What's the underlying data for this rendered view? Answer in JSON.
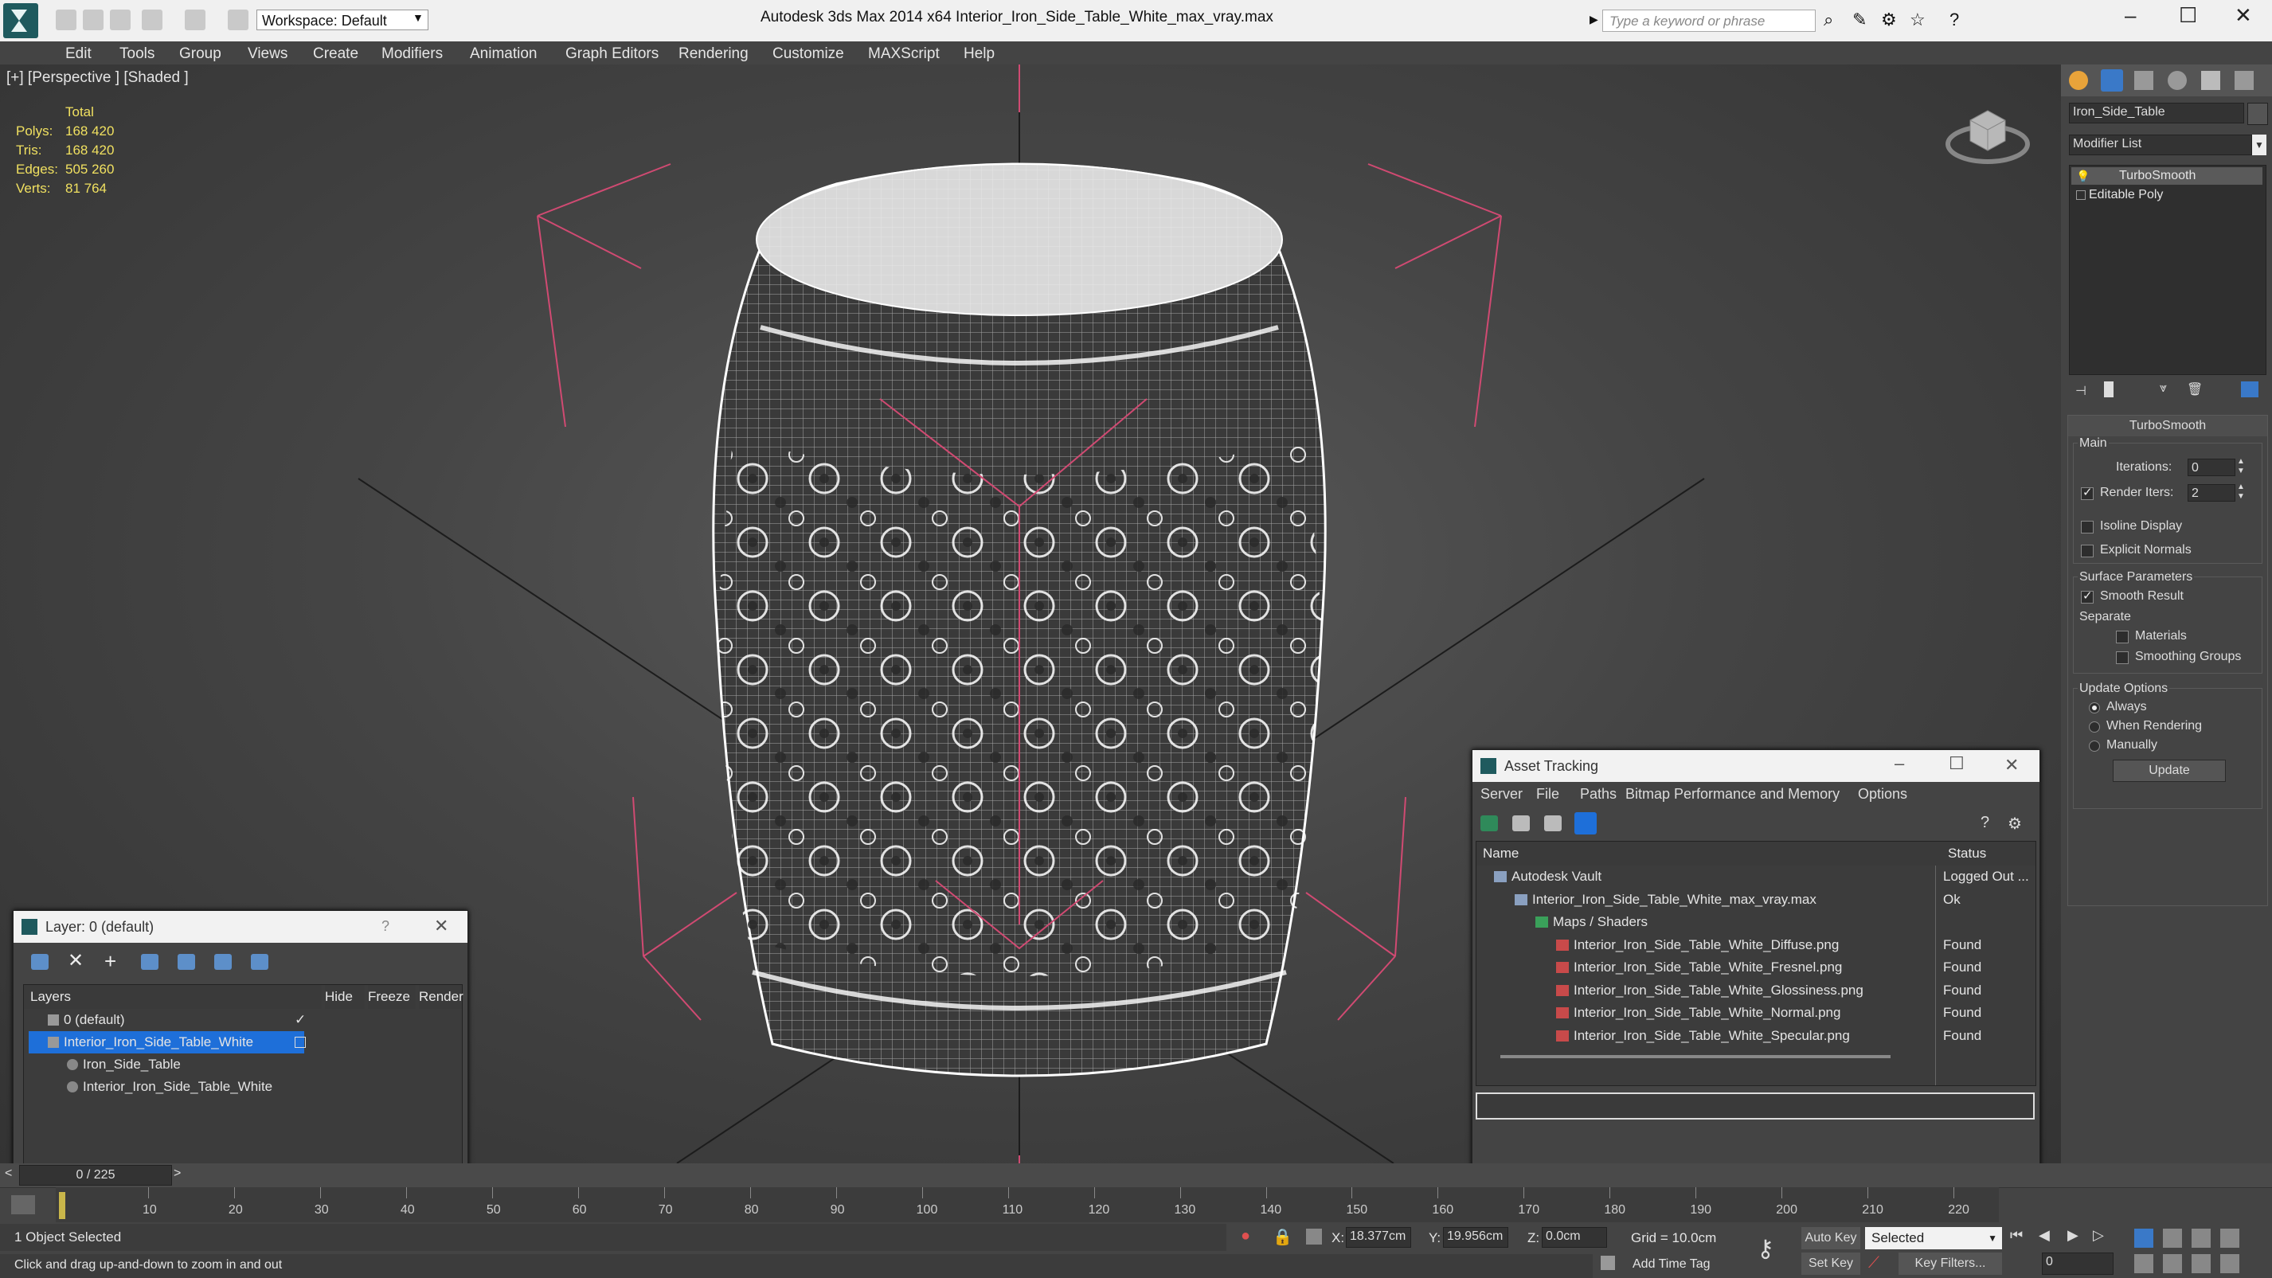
{
  "app": {
    "title": "Autodesk 3ds Max  2014 x64     Interior_Iron_Side_Table_White_max_vray.max",
    "workspace_label": "Workspace: Default",
    "search_placeholder": "Type a keyword or phrase"
  },
  "menu": [
    "Edit",
    "Tools",
    "Group",
    "Views",
    "Create",
    "Modifiers",
    "Animation",
    "Graph Editors",
    "Rendering",
    "Customize",
    "MAXScript",
    "Help"
  ],
  "viewport": {
    "label": "[+] [Perspective ] [Shaded ]",
    "stats": {
      "header": "Total",
      "rows": [
        {
          "key": "Polys:",
          "value": "168 420"
        },
        {
          "key": "Tris:",
          "value": "168 420"
        },
        {
          "key": "Edges:",
          "value": "505 260"
        },
        {
          "key": "Verts:",
          "value": "81 764"
        }
      ]
    }
  },
  "command_panel": {
    "object_name": "Iron_Side_Table",
    "modifier_list": "Modifier List",
    "stack": [
      "TurboSmooth",
      "Editable Poly"
    ],
    "rollout_title": "TurboSmooth",
    "main_label": "Main",
    "iterations_label": "Iterations:",
    "iterations_value": "0",
    "render_iters_label": "Render Iters:",
    "render_iters_value": "2",
    "isoline": "Isoline Display",
    "explicit": "Explicit Normals",
    "surface_params": "Surface Parameters",
    "smooth_result": "Smooth Result",
    "separate": "Separate",
    "materials": "Materials",
    "smoothing_groups": "Smoothing Groups",
    "update_options": "Update Options",
    "always": "Always",
    "when_rendering": "When Rendering",
    "manually": "Manually",
    "update_button": "Update"
  },
  "layer_window": {
    "title": "Layer: 0 (default)",
    "question": "?",
    "columns": [
      "Layers",
      "Hide",
      "Freeze",
      "Render"
    ],
    "rows": [
      {
        "name": "0 (default)",
        "indent": 1,
        "selected": false
      },
      {
        "name": "Interior_Iron_Side_Table_White",
        "indent": 1,
        "selected": true
      },
      {
        "name": "Iron_Side_Table",
        "indent": 2,
        "selected": false
      },
      {
        "name": "Interior_Iron_Side_Table_White",
        "indent": 2,
        "selected": false
      }
    ]
  },
  "asset_window": {
    "title": "Asset Tracking",
    "menu": [
      "Server",
      "File",
      "Paths",
      "Bitmap Performance and Memory",
      "Options"
    ],
    "columns": [
      "Name",
      "Status"
    ],
    "rows": [
      {
        "name": "Autodesk Vault",
        "status": "Logged Out ...",
        "indent": 1,
        "icon": "vault-icon"
      },
      {
        "name": "Interior_Iron_Side_Table_White_max_vray.max",
        "status": "Ok",
        "indent": 2,
        "icon": "max-file-icon"
      },
      {
        "name": "Maps / Shaders",
        "status": "",
        "indent": 3,
        "icon": "maps-icon"
      },
      {
        "name": "Interior_Iron_Side_Table_White_Diffuse.png",
        "status": "Found",
        "indent": 4,
        "icon": "png-icon"
      },
      {
        "name": "Interior_Iron_Side_Table_White_Fresnel.png",
        "status": "Found",
        "indent": 4,
        "icon": "png-icon"
      },
      {
        "name": "Interior_Iron_Side_Table_White_Glossiness.png",
        "status": "Found",
        "indent": 4,
        "icon": "png-icon"
      },
      {
        "name": "Interior_Iron_Side_Table_White_Normal.png",
        "status": "Found",
        "indent": 4,
        "icon": "png-icon"
      },
      {
        "name": "Interior_Iron_Side_Table_White_Specular.png",
        "status": "Found",
        "indent": 4,
        "icon": "png-icon"
      }
    ]
  },
  "timeline": {
    "frame_counter": "0 / 225",
    "ticks": [
      "10",
      "20",
      "30",
      "40",
      "50",
      "60",
      "70",
      "80",
      "90",
      "100",
      "110",
      "120",
      "130",
      "140",
      "150",
      "160",
      "170",
      "180",
      "190",
      "200",
      "210",
      "220"
    ]
  },
  "status": {
    "selection": "1 Object Selected",
    "prompt": "Click and drag up-and-down to zoom in and out",
    "x_label": "X:",
    "x_value": "18.377cm",
    "y_label": "Y:",
    "y_value": "19.956cm",
    "z_label": "Z:",
    "z_value": "0.0cm",
    "grid": "Grid = 10.0cm",
    "add_time_tag": "Add Time Tag",
    "auto_key": "Auto Key",
    "set_key": "Set Key",
    "selected": "Selected",
    "key_filters": "Key Filters...",
    "frame_value": "0"
  },
  "colors": {
    "accent_yellow": "#f0e060",
    "selection_blue": "#1e6fd9",
    "bbox_pink": "#d04a72"
  }
}
